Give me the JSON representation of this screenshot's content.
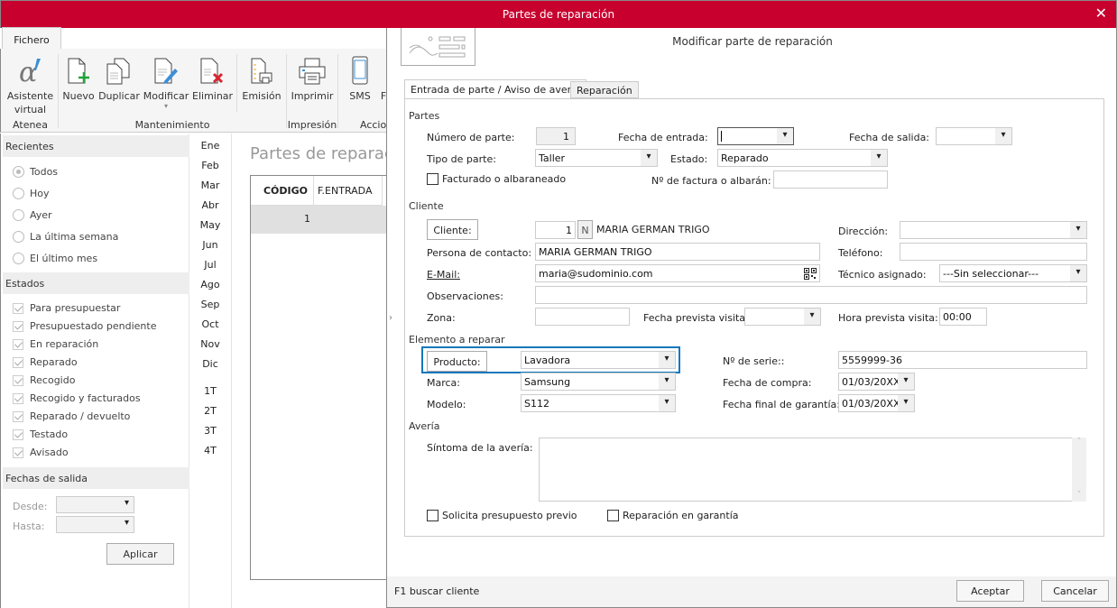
{
  "window": {
    "title": "Partes de reparación",
    "close_icon": "close-icon"
  },
  "ribbon": {
    "tab": "Fichero",
    "buttons": [
      {
        "label": "Asistente virtual",
        "icon": "alpha-assistant-icon"
      },
      {
        "label": "Nuevo",
        "icon": "new-document-icon"
      },
      {
        "label": "Duplicar",
        "icon": "duplicate-icon"
      },
      {
        "label": "Modificar",
        "icon": "edit-document-icon"
      },
      {
        "label": "Eliminar",
        "icon": "delete-document-icon"
      },
      {
        "label": "Emisión",
        "icon": "emission-icon"
      },
      {
        "label": "Imprimir",
        "icon": "printer-icon"
      },
      {
        "label": "SMS",
        "icon": "phone-icon"
      },
      {
        "label": "F"
      }
    ],
    "groups": [
      "Atenea",
      "Mantenimiento",
      "Impresión",
      "Accio"
    ]
  },
  "left_panel": {
    "recientes": {
      "header": "Recientes",
      "options": [
        {
          "label": "Todos",
          "selected": true
        },
        {
          "label": "Hoy",
          "selected": false
        },
        {
          "label": "Ayer",
          "selected": false
        },
        {
          "label": "La última semana",
          "selected": false
        },
        {
          "label": "El último mes",
          "selected": false
        }
      ]
    },
    "estados": {
      "header": "Estados",
      "items": [
        {
          "label": "Para presupuestar",
          "checked": true
        },
        {
          "label": "Presupuestado pendiente",
          "checked": true
        },
        {
          "label": "En reparación",
          "checked": true
        },
        {
          "label": "Reparado",
          "checked": true
        },
        {
          "label": "Recogido",
          "checked": true
        },
        {
          "label": "Recogido y facturados",
          "checked": true
        },
        {
          "label": "Reparado / devuelto",
          "checked": true
        },
        {
          "label": "Testado",
          "checked": true
        },
        {
          "label": "Avisado",
          "checked": true
        }
      ]
    },
    "fechas": {
      "header": "Fechas de salida",
      "desde_label": "Desde:",
      "hasta_label": "Hasta:",
      "desde_value": "",
      "hasta_value": "",
      "apply": "Aplicar"
    }
  },
  "months": [
    "Ene",
    "Feb",
    "Mar",
    "Abr",
    "May",
    "Jun",
    "Jul",
    "Ago",
    "Sep",
    "Oct",
    "Nov",
    "Dic"
  ],
  "quarters": [
    "1T",
    "2T",
    "3T",
    "4T"
  ],
  "list": {
    "title": "Partes de reparaci",
    "columns": [
      "CÓDIGO",
      "F.ENTRADA"
    ],
    "rows": [
      {
        "codigo": "1",
        "f_entrada": ""
      }
    ]
  },
  "dialog": {
    "title": "Modificar parte de reparación",
    "tabs": [
      "Entrada de parte / Aviso de avería",
      "Reparación"
    ],
    "partes": {
      "group": "Partes",
      "numero_label": "Número de parte:",
      "numero_value": "1",
      "fecha_entrada_label": "Fecha de entrada:",
      "fecha_entrada_value": "",
      "fecha_salida_label": "Fecha de salida:",
      "fecha_salida_value": "",
      "tipo_label": "Tipo de parte:",
      "tipo_value": "Taller",
      "estado_label": "Estado:",
      "estado_value": "Reparado",
      "facturado_label": "Facturado o albaraneado",
      "facturado_checked": false,
      "factura_label": "Nº de factura o albarán:",
      "factura_value": ""
    },
    "cliente": {
      "group": "Cliente",
      "cliente_button": "Cliente:",
      "cliente_code": "1",
      "n_button": "N",
      "cliente_name": "MARIA GERMAN TRIGO",
      "contacto_label": "Persona de contacto:",
      "contacto_value": "MARIA GERMAN TRIGO",
      "email_label": "E-Mail:",
      "email_value": "maria@sudominio.com",
      "observaciones_label": "Observaciones:",
      "observaciones_value": "",
      "zona_label": "Zona:",
      "zona_value": "",
      "fecha_visita_label": "Fecha prevista visita:",
      "fecha_visita_value": "",
      "direccion_label": "Dirección:",
      "direccion_value": "",
      "telefono_label": "Teléfono:",
      "telefono_value": "",
      "tecnico_label": "Técnico asignado:",
      "tecnico_value": "---Sin seleccionar---",
      "hora_visita_label": "Hora prevista visita:",
      "hora_visita_value": "00:00"
    },
    "elemento": {
      "group": "Elemento a reparar",
      "producto_button": "Producto:",
      "producto_value": "Lavadora",
      "marca_label": "Marca:",
      "marca_value": "Samsung",
      "modelo_label": "Modelo:",
      "modelo_value": "S112",
      "serie_label": "Nº de serie::",
      "serie_value": "5559999-36",
      "compra_label": "Fecha de compra:",
      "compra_value": "01/03/20XX",
      "garantia_label": "Fecha final de garantía:",
      "garantia_value": "01/03/20XX"
    },
    "averia": {
      "group": "Avería",
      "sintoma_label": "Síntoma de la avería:",
      "sintoma_value": "",
      "presupuesto_label": "Solicita presupuesto previo",
      "presupuesto_checked": false,
      "garantia_label": "Reparación en garantía",
      "garantia_checked": false
    },
    "footer": {
      "status": "F1 buscar cliente",
      "accept": "Aceptar",
      "cancel": "Cancelar"
    }
  }
}
